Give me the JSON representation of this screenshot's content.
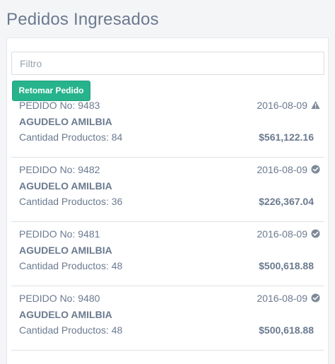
{
  "page": {
    "title": "Pedidos Ingresados"
  },
  "filter": {
    "placeholder": "Filtro",
    "value": ""
  },
  "actions": {
    "retomar_label": "Retomar Pedido"
  },
  "orders": [
    {
      "label": "PEDIDO No:",
      "number": "9483",
      "date": "2016-08-09",
      "client": "AGUDELO AMILBIA",
      "qty_label": "Cantidad Productos:",
      "qty": "84",
      "total": "$561,122.16",
      "status_icon": "warning-icon"
    },
    {
      "label": "PEDIDO No:",
      "number": "9482",
      "date": "2016-08-09",
      "client": "AGUDELO AMILBIA",
      "qty_label": "Cantidad Productos:",
      "qty": "36",
      "total": "$226,367.04",
      "status_icon": "check-circle-icon"
    },
    {
      "label": "PEDIDO No:",
      "number": "9481",
      "date": "2016-08-09",
      "client": "AGUDELO AMILBIA",
      "qty_label": "Cantidad Productos:",
      "qty": "48",
      "total": "$500,618.88",
      "status_icon": "check-circle-icon"
    },
    {
      "label": "PEDIDO No:",
      "number": "9480",
      "date": "2016-08-09",
      "client": "AGUDELO AMILBIA",
      "qty_label": "Cantidad Productos:",
      "qty": "48",
      "total": "$500,618.88",
      "status_icon": "check-circle-icon"
    }
  ],
  "colors": {
    "accent": "#27b38c",
    "text": "#6b7a8f",
    "icon": "#7f8a99"
  }
}
